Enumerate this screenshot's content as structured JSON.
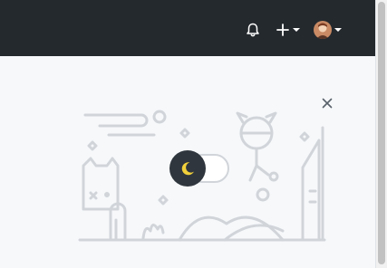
{
  "header": {
    "icons": {
      "notifications": "bell-icon",
      "create_new": "plus-icon",
      "create_caret": "caret-down-icon",
      "user_avatar": "avatar-image",
      "user_caret": "caret-down-icon"
    }
  },
  "dialog": {
    "close_icon": "close-icon",
    "theme_toggle": {
      "icon": "moon-icon",
      "state": "dark"
    }
  },
  "colors": {
    "header_bg": "#24292e",
    "page_bg": "#f6f8fa",
    "illustration_stroke": "#d1d5da",
    "toggle_knob": "#2f363d",
    "moon": "#f1d03b"
  }
}
